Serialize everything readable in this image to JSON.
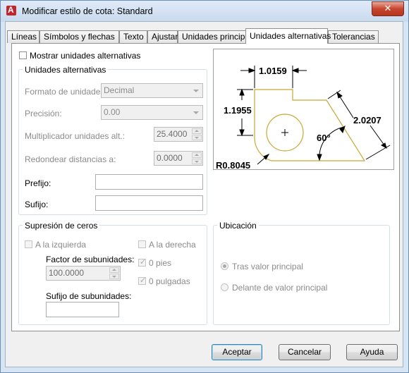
{
  "window": {
    "title": "Modificar estilo de cota: Standard",
    "close_glyph": "✕"
  },
  "tabs": [
    {
      "label": "Líneas"
    },
    {
      "label": "Símbolos y flechas"
    },
    {
      "label": "Texto"
    },
    {
      "label": "Ajustar"
    },
    {
      "label": "Unidades principales"
    },
    {
      "label": "Unidades alternativas",
      "active": true
    },
    {
      "label": "Tolerancias"
    }
  ],
  "show_alt": {
    "label": "Mostrar unidades alternativas",
    "checked": false
  },
  "alt_units": {
    "title": "Unidades alternativas",
    "format_label": "Formato de unidades:",
    "format_value": "Decimal",
    "precision_label": "Precisión:",
    "precision_value": "0.00",
    "multiplier_label": "Multiplicador unidades alt.:",
    "multiplier_value": "25.4000",
    "round_label": "Redondear distancias a:",
    "round_value": "0.0000",
    "prefix_label": "Prefijo:",
    "prefix_value": "",
    "suffix_label": "Sufijo:",
    "suffix_value": ""
  },
  "preview": {
    "dim_top": "1.0159",
    "dim_left": "1.1955",
    "dim_right": "2.0207",
    "angle": "60°",
    "radius": "R0.8045"
  },
  "zero_suppression": {
    "title": "Supresión de ceros",
    "left_label": "A la izquierda",
    "right_label": "A la derecha",
    "sub_factor_label": "Factor de subunidades:",
    "sub_factor_value": "100.0000",
    "feet_label": "0 pies",
    "inches_label": "0 pulgadas",
    "sub_suffix_label": "Sufijo de subunidades:",
    "sub_suffix_value": ""
  },
  "placement": {
    "title": "Ubicación",
    "after_label": "Tras valor principal",
    "before_label": "Delante de valor principal",
    "selected": "after"
  },
  "buttons": {
    "ok": "Aceptar",
    "cancel": "Cancelar",
    "help": "Ayuda"
  },
  "colors": {
    "preview_geometry": "#c8a832",
    "preview_dims": "#000000"
  }
}
